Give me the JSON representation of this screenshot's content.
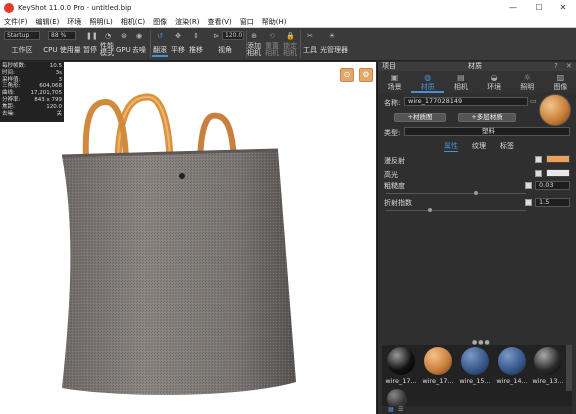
{
  "window": {
    "title": "KeyShot 11.0.0 Pro - untitled.bip",
    "controls": [
      "—",
      "☐",
      "✕"
    ]
  },
  "menu": [
    "文件(F)",
    "编辑(E)",
    "环境",
    "照明(L)",
    "相机(C)",
    "图像",
    "渲染(R)",
    "查看(V)",
    "窗口",
    "帮助(H)"
  ],
  "toolbar": {
    "workspace_value": "Startup",
    "cpu_value": "88 %",
    "zoom_value": "120.0",
    "buttons": [
      "工作区",
      "CPU 使用量",
      "暂停",
      "性能模式",
      "GPU",
      "去噪",
      "翻滚",
      "平移",
      "推移",
      "视角",
      "添加相机",
      "重置相机",
      "锁定相机",
      "工具",
      "光管理器"
    ]
  },
  "stats": [
    {
      "label": "每秒帧数:",
      "value": "10.5"
    },
    {
      "label": "时间:",
      "value": "3s"
    },
    {
      "label": "采样值:",
      "value": "3"
    },
    {
      "label": "三角形:",
      "value": "604,068"
    },
    {
      "label": "曲线:",
      "value": "17,201,705"
    },
    {
      "label": "分辨率:",
      "value": "843 x 799"
    },
    {
      "label": "焦距:",
      "value": "120.0"
    },
    {
      "label": "去噪:",
      "value": "关"
    }
  ],
  "panel": {
    "header_left": "项目",
    "header_center": "材质",
    "tabs": [
      {
        "label": "场景",
        "icon": "scene-icon"
      },
      {
        "label": "材质",
        "icon": "material-icon",
        "active": true
      },
      {
        "label": "相机",
        "icon": "camera-icon"
      },
      {
        "label": "环境",
        "icon": "environment-icon"
      },
      {
        "label": "照明",
        "icon": "light-icon"
      },
      {
        "label": "图像",
        "icon": "image-icon"
      }
    ],
    "name_label": "名称:",
    "name_value": "wire_177028149",
    "material_graph": "材质图",
    "multi_layer": "多层材质",
    "type_label": "类型:",
    "type_value": "塑料",
    "subtabs": [
      "属性",
      "纹理",
      "标签"
    ],
    "props": [
      {
        "label": "漫反射",
        "color": "#e8a05a"
      },
      {
        "label": "高光",
        "color": "#e8e8e8"
      },
      {
        "label": "粗糙度",
        "value": "0.03"
      },
      {
        "label": "折射指数",
        "value": "1.5"
      }
    ]
  },
  "library": [
    {
      "label": "wire_17...",
      "color": "#1a1a1a"
    },
    {
      "label": "wire_17...",
      "color": "#c9803e"
    },
    {
      "label": "wire_15...",
      "color": "#3a5a8c"
    },
    {
      "label": "wire_14...",
      "color": "#3a5a8c"
    },
    {
      "label": "wire_13...",
      "color": "#2a2a2a"
    }
  ]
}
